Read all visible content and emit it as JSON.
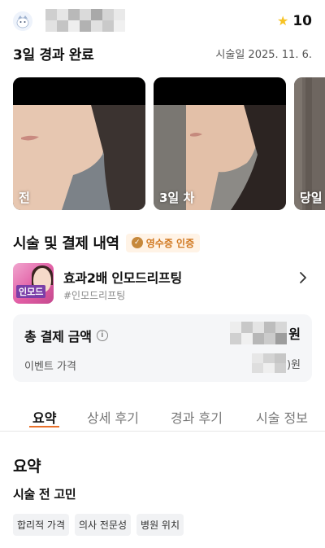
{
  "header": {
    "avatar_icon": "profile-avatar-icon",
    "rating_icon": "star-icon",
    "rating": "10"
  },
  "result": {
    "title": "3일 경과 완료",
    "procedure_date": "시술일 2025. 11. 6."
  },
  "photos": [
    {
      "label": "전"
    },
    {
      "label": "3일 차"
    },
    {
      "label": "당일"
    }
  ],
  "payment_section": {
    "title": "시술 및 결제 내역",
    "badge": "영수증 인증",
    "product": {
      "thumb_tag": "인모드",
      "name": "효과2배 인모드리프팅",
      "hashtag": "#인모드리프팅"
    },
    "total_label": "총 결제 금액",
    "total_currency": "원",
    "event_label": "이벤트 가격",
    "event_currency": ")원"
  },
  "tabs": [
    {
      "label": "요약",
      "active": true
    },
    {
      "label": "상세 후기",
      "active": false
    },
    {
      "label": "경과 후기",
      "active": false
    },
    {
      "label": "시술 정보",
      "active": false
    }
  ],
  "summary": {
    "title": "요약",
    "concern_title": "시술 전 고민",
    "chips": [
      "합리적 가격",
      "의사 전문성",
      "병원 위치"
    ]
  },
  "colors": {
    "accent": "#e8702a",
    "star": "#f7c324",
    "badge_bg": "#fff3e6",
    "badge_text": "#d0771e"
  }
}
